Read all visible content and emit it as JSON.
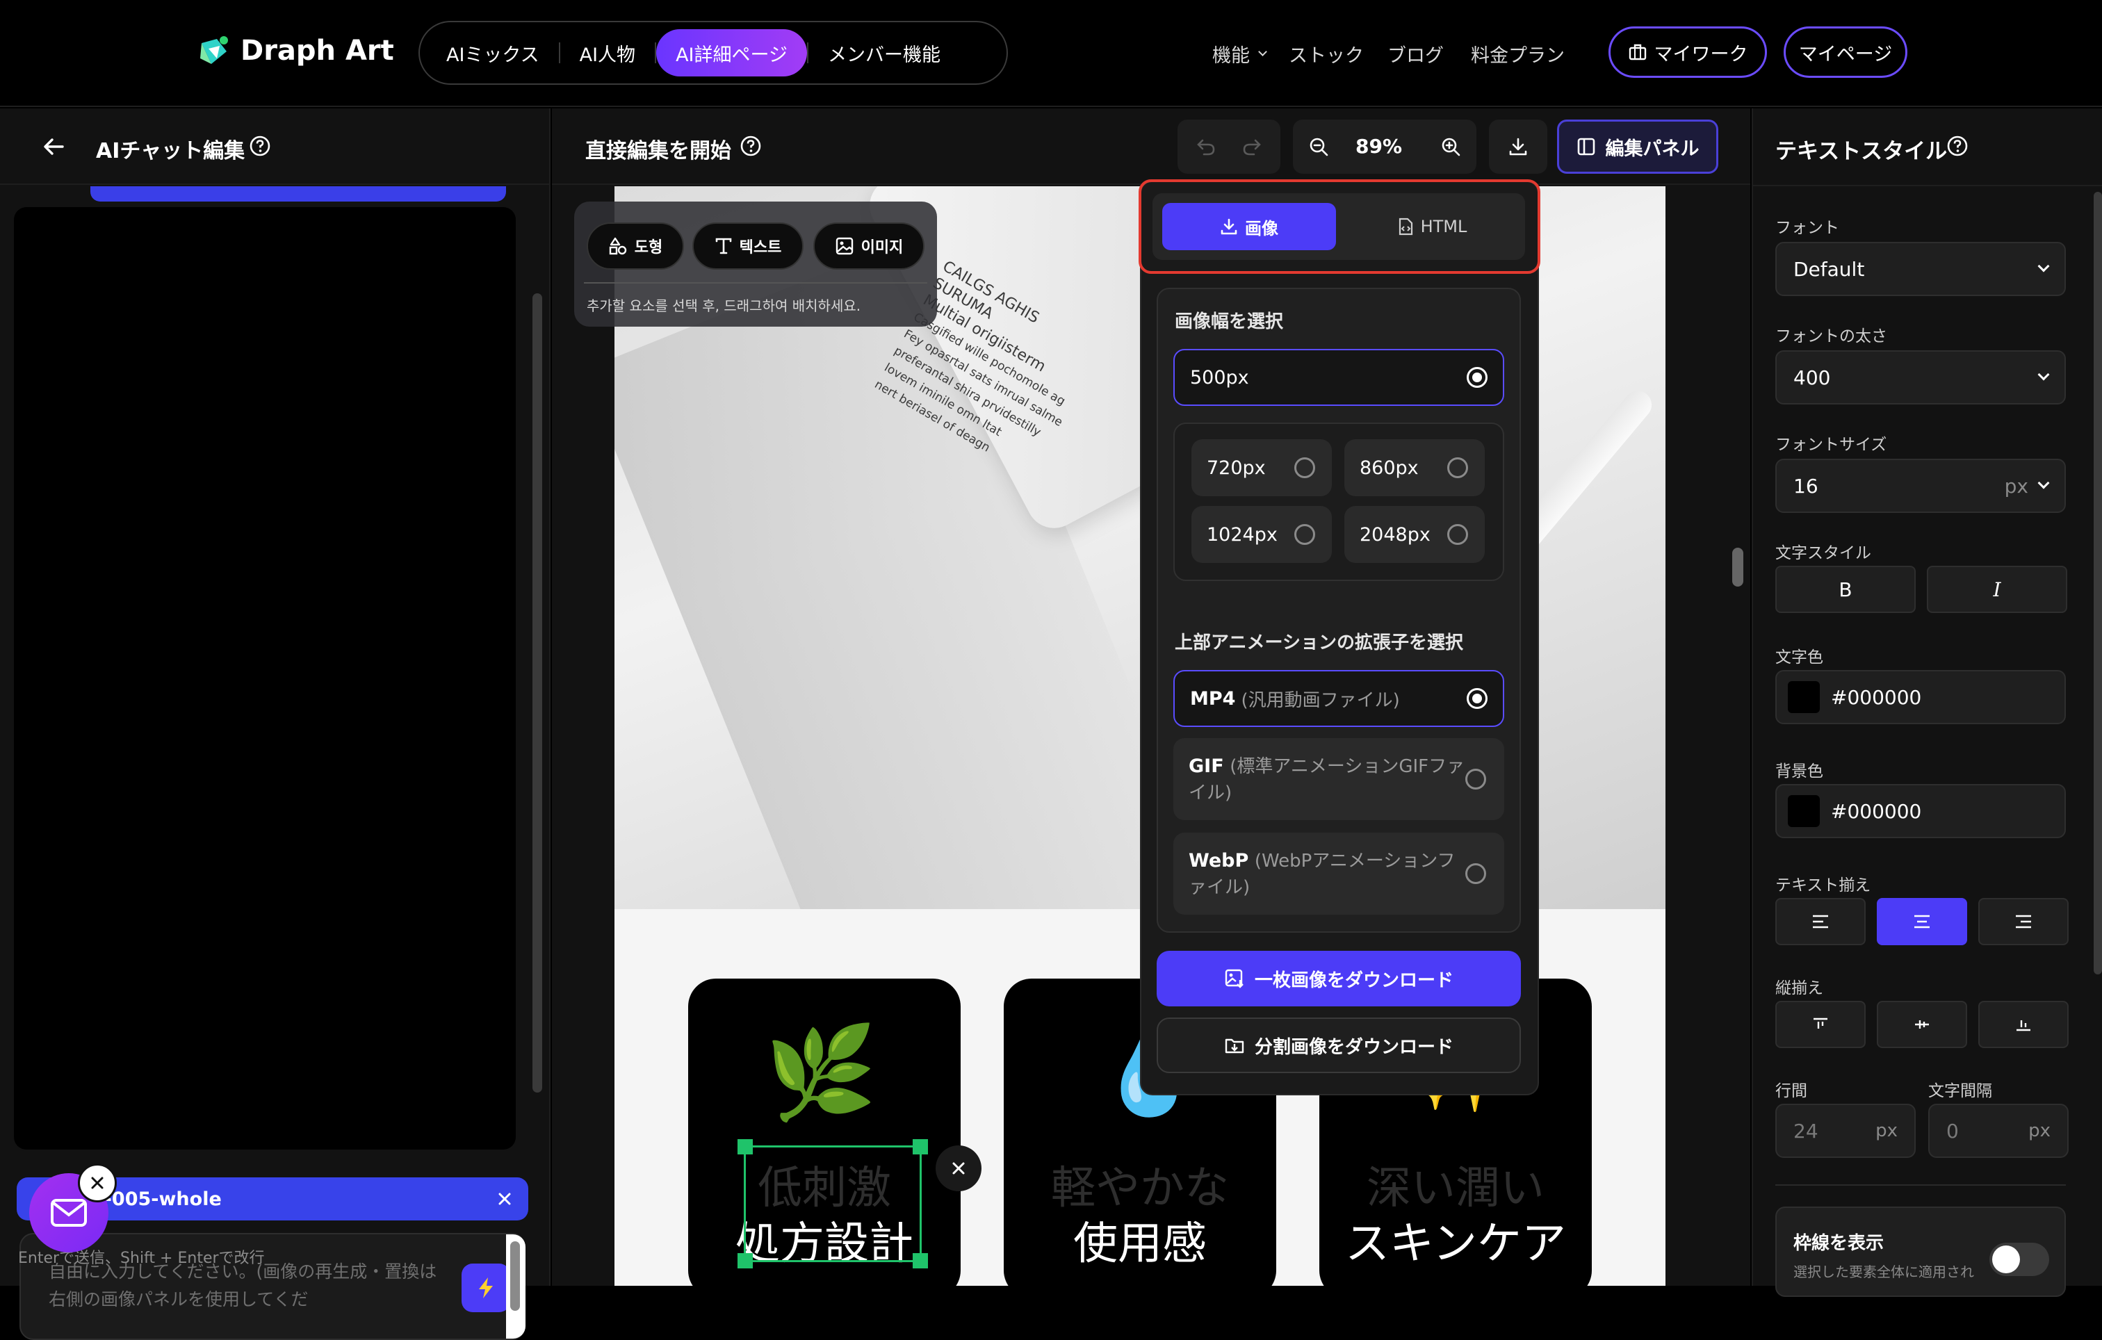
{
  "header": {
    "brand": "Draph Art",
    "nav_tabs": [
      {
        "label": "AIミックス"
      },
      {
        "label": "AI人物"
      },
      {
        "label": "AI詳細ページ"
      },
      {
        "label": "メンバー機能"
      }
    ],
    "right_links": {
      "features": "機能",
      "stock": "ストック",
      "blog": "ブログ",
      "pricing": "料金プラン"
    },
    "my_work": "マイワーク",
    "my_page": "マイページ"
  },
  "left_panel": {
    "title": "AIチャット編集",
    "block_tag": "#block-005-whole",
    "chat_placeholder": "自由に入力してください。(画像の再生成・置換は右側の画像パネルを使用してくだ",
    "hint": "Enterで送信、Shift + Enterで改行"
  },
  "center": {
    "title": "直接編集を開始",
    "zoom": "89%",
    "edit_panel": "編集パネル",
    "tools": {
      "shape": "도형",
      "text": "텍스트",
      "image": "이미지"
    },
    "tool_hint": "추가할 요소를 선택 후, 드래그하여 배치하세요.",
    "bottle_text": [
      "CAILGS AGHIS",
      "SURUMA",
      "Multial origiisterm",
      "Casgified wille pochomole ag",
      "Fey opasrtal sats imrual salme",
      "preferantal shira prvidestilly",
      "lovem iminile omn ltat",
      "nert beriasel of deagn"
    ],
    "cards": [
      {
        "emoji": "🌿",
        "top": "低刺激",
        "bottom": "処方設計"
      },
      {
        "emoji": "💧",
        "top": "軽やかな",
        "bottom": "使用感"
      },
      {
        "emoji": "✨",
        "top": "深い潤い",
        "bottom": "スキンケア"
      }
    ]
  },
  "download_popup": {
    "tabs": {
      "image": "画像",
      "html": "HTML"
    },
    "width_title": "画像幅を選択",
    "width_selected": "500px",
    "width_options": [
      "720px",
      "860px",
      "1024px",
      "2048px"
    ],
    "ext_title": "上部アニメーションの拡張子を選択",
    "ext_options": [
      {
        "name": "MP4",
        "desc": "(汎用動画ファイル)",
        "desc2": ""
      },
      {
        "name": "GIF",
        "desc": "(標準アニメーションGIFファ",
        "desc2": "イル)"
      },
      {
        "name": "WebP",
        "desc": "(WebPアニメーションフ",
        "desc2": "ァイル)"
      }
    ],
    "download_single": "一枚画像をダウンロード",
    "download_split": "分割画像をダウンロード"
  },
  "right_panel": {
    "title": "テキストスタイル",
    "font_label": "フォント",
    "font_value": "Default",
    "weight_label": "フォントの太さ",
    "weight_value": "400",
    "size_label": "フォントサイズ",
    "size_value": "16",
    "size_unit": "px",
    "style_label": "文字スタイル",
    "bold": "B",
    "italic": "I",
    "color_label": "文字色",
    "color_value": "#000000",
    "bg_label": "背景色",
    "bg_value": "#000000",
    "align_label": "テキスト揃え",
    "valign_label": "縦揃え",
    "line_label": "行間",
    "line_value": "24",
    "spacing_label": "文字間隔",
    "spacing_value": "0",
    "unit_px": "px",
    "border_title": "枠線を表示",
    "border_desc": "選択した要素全体に適用され"
  },
  "colors": {
    "accent": "#4c3cf7",
    "highlight": "#e33a30",
    "tag_blue": "#3843ea"
  }
}
